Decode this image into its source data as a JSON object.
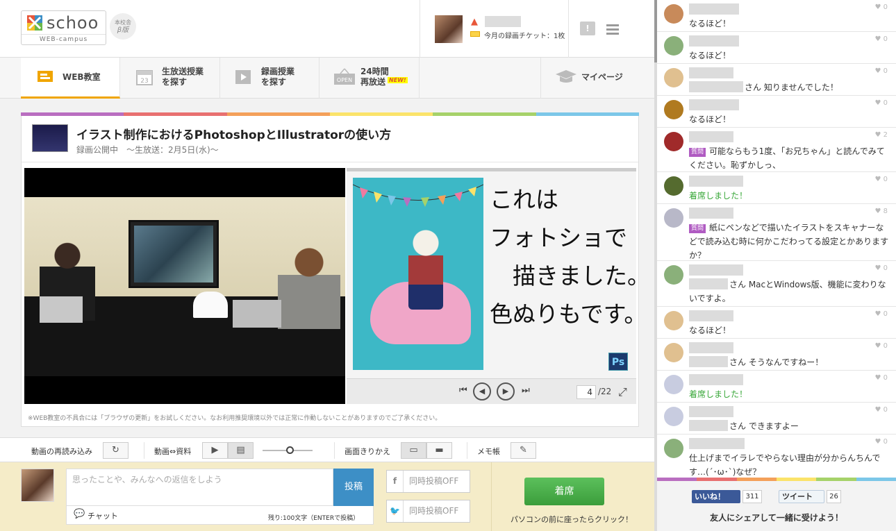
{
  "header": {
    "logo_text": "schoo",
    "logo_sub": "WEB-campus",
    "beta_top": "本校舎",
    "beta_bottom": "β版",
    "ticket_text": "今月の録画チケット：1枚",
    "notif_glyph": "!"
  },
  "nav": {
    "items": [
      {
        "label": "WEB教室",
        "icon": "classroom-icon",
        "active": true
      },
      {
        "label": "生放送授業\nを探す",
        "icon": "calendar-icon",
        "calendar_day": "23"
      },
      {
        "label": "録画授業\nを探す",
        "icon": "play-icon"
      },
      {
        "label": "24時間\n再放送",
        "icon": "open-sign-icon",
        "badge": "NEW!",
        "sign_text": "OPEN"
      },
      {
        "label": "マイページ",
        "icon": "mortarboard-icon"
      }
    ]
  },
  "colors": {
    "rainbow": [
      "#b96ec0",
      "#e87070",
      "#f4a05a",
      "#fbe36a",
      "#a6d26a",
      "#7cc7e8"
    ],
    "accent_blue": "#3d8fc6",
    "seat_green": "#4cb04c",
    "question_purple": "#b05bc2"
  },
  "course": {
    "title": "イラスト制作におけるPhotoshopとIllustratorの使い方",
    "subtitle": "録画公開中　～生放送：2月5日(水)～"
  },
  "slide": {
    "handwritten_text": "これは\nフォトショで\n　描きました。\n色ぬりもです。",
    "ps_label": "Ps",
    "current_page": "4",
    "total_pages": "/22"
  },
  "notice": "※WEB教室の不具合には「ブラウザの更新」をお試しください。なお利用推奨環境以外では正常に作動しないことがありますのでご了承ください。",
  "toolbar": {
    "reload_label": "動画の再読み込み",
    "video_doc_label": "動画⇔資料",
    "screen_switch_label": "画面きりかえ",
    "memo_label": "メモ帳",
    "slider_value": 0.55
  },
  "compose": {
    "placeholder": "思ったことや、みんなへの返信をしよう",
    "post_label": "投稿",
    "chat_tab": "チャット",
    "remaining": "残り:100文字（ENTERで投稿）",
    "fb_share": "同時投稿OFF",
    "tw_share": "同時投稿OFF",
    "seat_label": "着席",
    "seat_hint": "パソコンの前に座ったらクリック！"
  },
  "chat": {
    "messages": [
      {
        "likes": "0",
        "text": "なるほど！",
        "avatar": "#c88a5a"
      },
      {
        "likes": "0",
        "text": "なるほど！",
        "avatar": "#8ab07a"
      },
      {
        "likes": "0",
        "prefix_box": true,
        "text": "さん 知りませんでした！",
        "avatar": "#e0c090"
      },
      {
        "likes": "0",
        "text": "なるほど！",
        "avatar": "#b07a20"
      },
      {
        "likes": "2",
        "question": "質問",
        "text": "可能ならもう1度、「お兄ちゃん」と読んでみてください。恥ずかしっ、",
        "avatar": "#a02a2a"
      },
      {
        "likes": "0",
        "text": "着席しました！",
        "green": true,
        "avatar": "#556b2f"
      },
      {
        "likes": "8",
        "question": "質問",
        "text": "紙にペンなどで描いたイラストをスキャナーなどで読み込む時に何かこだわってる設定とかありますか？",
        "avatar": "#b8b8c8"
      },
      {
        "likes": "0",
        "prefix_box": true,
        "text": "さん MacとWindows版、機能に変わりないですよ。",
        "avatar": "#8ab07a"
      },
      {
        "likes": "0",
        "text": "なるほど！",
        "avatar": "#e0c090"
      },
      {
        "likes": "0",
        "prefix_box": true,
        "text": "さん そうなんですねー！",
        "avatar": "#e0c090"
      },
      {
        "likes": "0",
        "text": "着席しました！",
        "green": true,
        "avatar": "#c8cce0"
      },
      {
        "likes": "0",
        "prefix_box": true,
        "text": "さん できますよー",
        "avatar": "#c8cce0"
      },
      {
        "likes": "0",
        "text": "仕上げまでイラレでやらない理由が分からんちんです…(´･ω･`)なぜ？",
        "avatar": "#8ab07a"
      }
    ],
    "like_glyph": "♥"
  },
  "social": {
    "fb_label": "いいね！",
    "fb_count": "311",
    "tw_label": "ツイート",
    "tw_count": "26",
    "share_text": "友人にシェアして一緒に受けよう！"
  }
}
